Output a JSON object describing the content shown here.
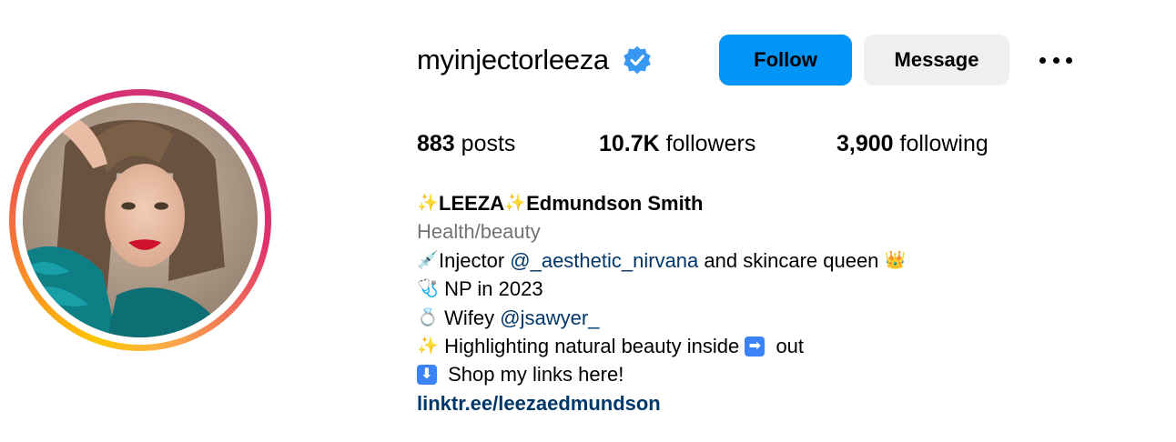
{
  "profile": {
    "username": "myinjectorleeza",
    "verified_icon": "verified-badge-icon",
    "avatar_icon": "profile-photo",
    "accent_colors": {
      "follow_bg": "#0095f6",
      "message_bg": "#efefef",
      "link": "#00376b",
      "category": "#737373"
    }
  },
  "actions": {
    "follow_label": "Follow",
    "message_label": "Message",
    "more_icon": "more-options-icon"
  },
  "stats": {
    "posts_count": "883",
    "posts_label": "posts",
    "followers_count": "10.7K",
    "followers_label": "followers",
    "following_count": "3,900",
    "following_label": "following"
  },
  "bio": {
    "name_sparkle_left": "✨",
    "name_first": "LEEZA",
    "name_sparkle_right": "✨",
    "name_rest": " Edmundson Smith",
    "category": "Health/beauty",
    "line1_emoji": "💉",
    "line1_prefix": "Injector ",
    "line1_mention": "@_aesthetic_nirvana",
    "line1_suffix": " and skincare queen ",
    "line1_end_emoji": "👑",
    "line2_emoji": "🩺",
    "line2_text": " NP in 2023",
    "line3_emoji": "💍",
    "line3_prefix": " Wifey ",
    "line3_mention": "@jsawyer_",
    "line4_emoji": "✨",
    "line4_text_a": " Highlighting natural beauty inside ",
    "line4_arrow": "➡",
    "line4_text_b": " out",
    "line5_arrow": "⬇",
    "line5_text": " Shop my links here!",
    "link": "linktr.ee/leezaedmundson"
  }
}
